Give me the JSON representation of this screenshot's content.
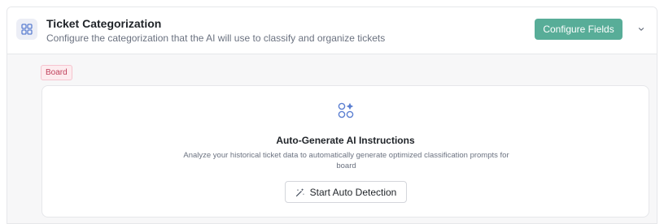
{
  "header": {
    "title": "Ticket Categorization",
    "subtitle": "Configure the categorization that the AI will use to classify and organize tickets",
    "configure_label": "Configure Fields",
    "category_icon": "grid-icon",
    "toggle_icon": "chevron-down-icon"
  },
  "board": {
    "badge": "Board"
  },
  "auto_generate": {
    "icon": "ai-sparkle-icon",
    "title": "Auto-Generate AI Instructions",
    "description": "Analyze your historical ticket data to automatically generate optimized classification prompts for board",
    "button_label": "Start Auto Detection",
    "button_icon": "magic-wand-icon"
  },
  "colors": {
    "accent": "#58ad98",
    "badge_bg": "#fdecef",
    "badge_text": "#c0415c",
    "icon_blue": "#5b7fd1"
  }
}
